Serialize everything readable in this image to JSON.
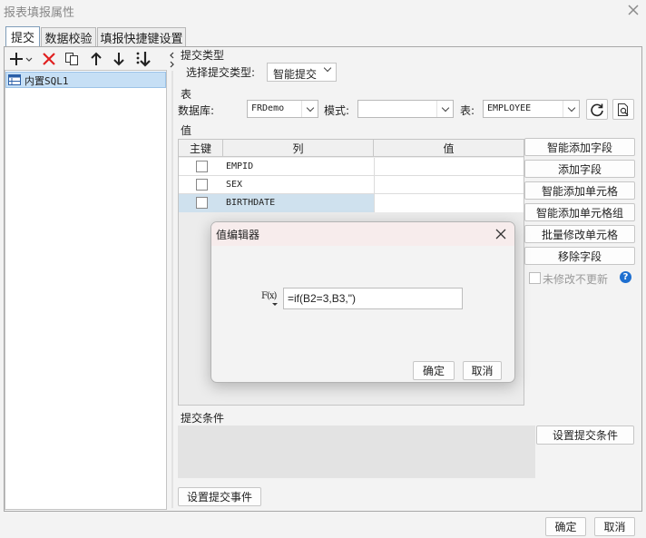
{
  "window": {
    "title": "报表填报属性"
  },
  "tabs": [
    {
      "label": "提交",
      "active": true
    },
    {
      "label": "数据校验"
    },
    {
      "label": "填报快捷键设置"
    }
  ],
  "left_panel": {
    "items": [
      {
        "label": "内置SQL1",
        "selected": true
      }
    ]
  },
  "submit_type": {
    "section_label": "提交类型",
    "select_label": "选择提交类型:",
    "value": "智能提交"
  },
  "table_section": {
    "section_label": "表",
    "db_label": "数据库:",
    "db_value": "FRDemo",
    "schema_label": "模式:",
    "schema_value": "",
    "table_label": "表:",
    "table_value": "EMPLOYEE"
  },
  "value_section": {
    "section_label": "值",
    "headers": {
      "key": "主键",
      "column": "列",
      "value": "值"
    },
    "rows": [
      {
        "column": "EMPID",
        "value": ""
      },
      {
        "column": "SEX",
        "value": ""
      },
      {
        "column": "BIRTHDATE",
        "value": ""
      }
    ]
  },
  "side_buttons": {
    "smart_add_field": "智能添加字段",
    "add_field": "添加字段",
    "smart_add_cell": "智能添加单元格",
    "smart_add_cell_group": "智能添加单元格组",
    "batch_modify_cell": "批量修改单元格",
    "remove_field": "移除字段",
    "no_update_label": "未修改不更新"
  },
  "condition": {
    "section_label": "提交条件",
    "set_button": "设置提交条件"
  },
  "event_button": "设置提交事件",
  "footer": {
    "ok": "确定",
    "cancel": "取消"
  },
  "value_editor": {
    "title": "值编辑器",
    "formula_icon_text": "F(x)",
    "formula_value": "=if(B2=3,B3,\")",
    "ok": "确定",
    "cancel": "取消"
  }
}
